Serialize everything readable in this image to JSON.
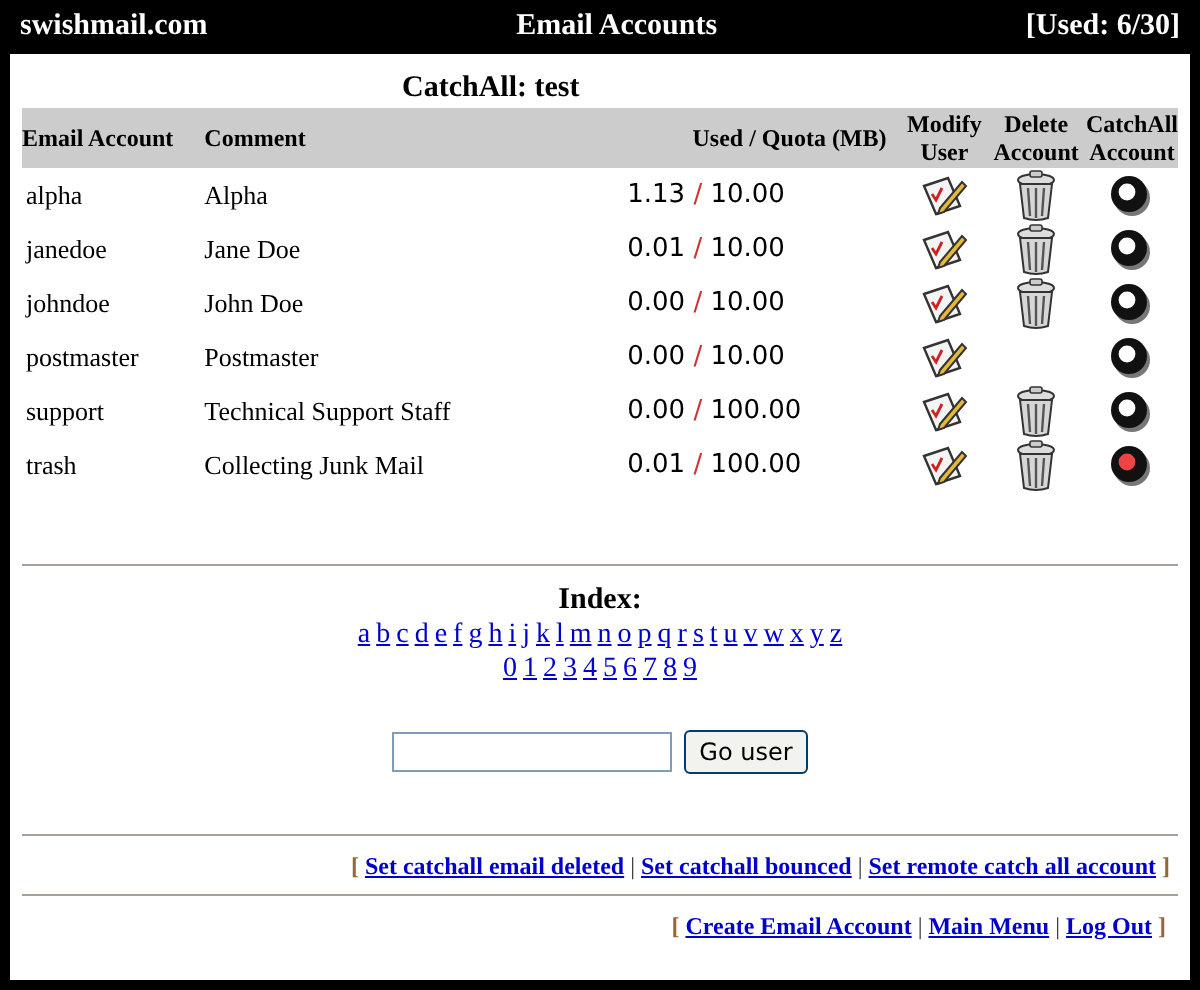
{
  "header": {
    "site": "swishmail.com",
    "title": "Email Accounts",
    "usage": "[Used: 6/30]"
  },
  "catchall": "CatchAll: test",
  "table": {
    "columns": [
      {
        "label": "Email Account"
      },
      {
        "label": "Comment"
      },
      {
        "label": "Used / Quota (MB)"
      },
      {
        "label": "Modify User"
      },
      {
        "label": "Delete Account"
      },
      {
        "label": "CatchAll Account"
      }
    ],
    "rows": [
      {
        "account": "alpha",
        "comment": "Alpha",
        "used": "1.13",
        "quota": "10.00",
        "deletable": true,
        "selected": false
      },
      {
        "account": "janedoe",
        "comment": "Jane Doe",
        "used": "0.01",
        "quota": "10.00",
        "deletable": true,
        "selected": false
      },
      {
        "account": "johndoe",
        "comment": "John Doe",
        "used": "0.00",
        "quota": "10.00",
        "deletable": true,
        "selected": false
      },
      {
        "account": "postmaster",
        "comment": "Postmaster",
        "used": "0.00",
        "quota": "10.00",
        "deletable": false,
        "selected": false
      },
      {
        "account": "support",
        "comment": "Technical Support Staff",
        "used": "0.00",
        "quota": "100.00",
        "deletable": true,
        "selected": false
      },
      {
        "account": "trash",
        "comment": "Collecting Junk Mail",
        "used": "0.01",
        "quota": "100.00",
        "deletable": true,
        "selected": true
      }
    ]
  },
  "index": {
    "title": "Index:",
    "letters": [
      "a",
      "b",
      "c",
      "d",
      "e",
      "f",
      "g",
      "h",
      "i",
      "j",
      "k",
      "l",
      "m",
      "n",
      "o",
      "p",
      "q",
      "r",
      "s",
      "t",
      "u",
      "v",
      "w",
      "x",
      "y",
      "z"
    ],
    "digits": [
      "0",
      "1",
      "2",
      "3",
      "4",
      "5",
      "6",
      "7",
      "8",
      "9"
    ]
  },
  "go_user": {
    "button": "Go user"
  },
  "bracket_open": "[",
  "bracket_close": "]",
  "separator": "|",
  "slash": "/",
  "catchall_links": [
    "Set catchall email deleted",
    "Set catchall bounced",
    "Set remote catch all account"
  ],
  "footer_links": [
    "Create Email Account",
    "Main Menu",
    "Log Out"
  ]
}
